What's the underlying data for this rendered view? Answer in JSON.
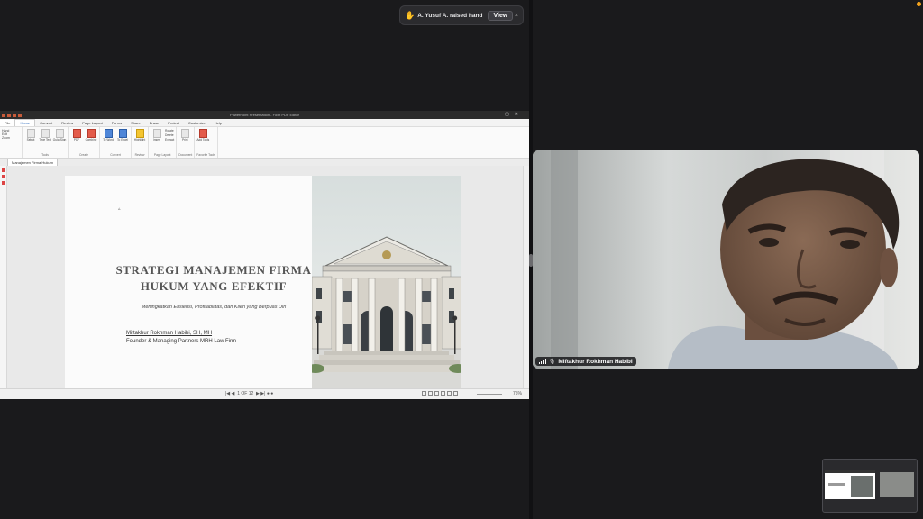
{
  "notification": {
    "icon": "raised-hand-icon",
    "text": "A. Yusuf A. raised hand",
    "view_label": "View",
    "close_label": "×"
  },
  "app": {
    "window_title": "PowerPoint Presentation - Foxit PDF Editor",
    "menu": [
      "File",
      "Home",
      "Convert",
      "Review",
      "Page Layout",
      "Forms",
      "Share",
      "Erase",
      "Protect",
      "Customize",
      "Help"
    ],
    "active_menu": "Home",
    "ribbon_groups": [
      {
        "name": "Tools",
        "buttons": [
          "Select",
          "Type Text",
          "QuickSign"
        ]
      },
      {
        "name": "Create",
        "buttons": [
          "PDF",
          "Combine"
        ]
      },
      {
        "name": "Convert",
        "buttons": [
          "To Word",
          "To Excel"
        ]
      },
      {
        "name": "Review",
        "buttons": [
          "Highlight"
        ]
      },
      {
        "name": "Page Layout",
        "buttons": [
          "Insert",
          "Rotate",
          "Delete",
          "Extract"
        ]
      },
      {
        "name": "Document",
        "buttons": [
          "Print"
        ]
      },
      {
        "name": "Favorite Tools",
        "buttons": [
          "Add Tools"
        ]
      }
    ],
    "left_panel": [
      "Hand",
      "Edit",
      "Zoom"
    ],
    "doc_tab": "Manajemen Firma Hukum",
    "page_indicator": "1 OF 12",
    "zoom_level": "75%"
  },
  "slide": {
    "title_line1": "Strategi Manajemen Firma",
    "title_line2": "Hukum yang Efektif",
    "subtitle": "Meningkatkan Efisiensi, Profitabilitas, dan Klien yang Berpuas Diri",
    "presenter_name": "Miftakhur Rokhman Habibi, SH, MH",
    "presenter_role": "Founder & Managing Partners MRH Law Firm"
  },
  "camera": {
    "participant_name": "Miftakhur Rokhman Habibi"
  },
  "colors": {
    "accent_notification": "#2b2b2e",
    "active_indicator": "#f3a21c",
    "background": "#1a1a1c"
  }
}
